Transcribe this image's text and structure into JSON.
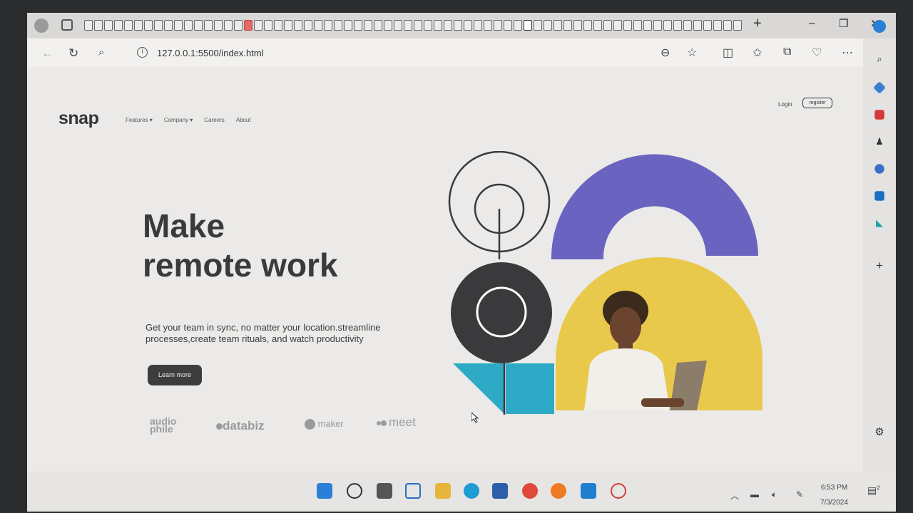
{
  "browser": {
    "new_tab": "+",
    "minimize": "–",
    "restore": "❐",
    "close": "✕",
    "url": "127.0.0.1:5500/index.html",
    "info_icon": "i"
  },
  "site": {
    "logo": "snap",
    "nav": [
      "Features ▾",
      "Company ▾",
      "Careers",
      "About"
    ],
    "login": "Login",
    "register": "register",
    "headline_line1": "Make",
    "headline_line2": "remote work",
    "subtext": "Get your team in sync, no matter your location.streamline processes,create team rituals, and watch productivity",
    "cta": "Learn more",
    "clients": [
      "audio phile",
      "databiz",
      "maker",
      "meet"
    ],
    "colors": {
      "purple": "#6a64c0",
      "yellow": "#e9c94c",
      "teal": "#2eaac6",
      "dark": "#3a3a3c"
    }
  },
  "taskbar": {
    "time": "6:53 PM",
    "date": "7/3/2024",
    "notifications": "2"
  }
}
